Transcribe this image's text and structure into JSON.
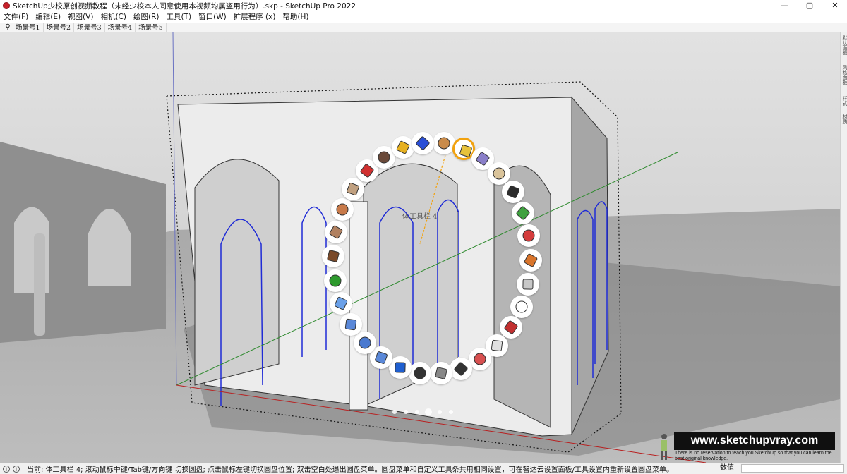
{
  "window": {
    "title": "SketchUp少校原创视频教程（未经少校本人同意使用本视频均属盗用行为）.skp - SketchUp Pro 2022",
    "minimize": "—",
    "maximize": "▢",
    "close": "✕"
  },
  "menu": [
    "文件(F)",
    "编辑(E)",
    "视图(V)",
    "相机(C)",
    "绘图(R)",
    "工具(T)",
    "窗口(W)",
    "扩展程序 (x)",
    "帮助(H)"
  ],
  "scenes": [
    "场景号1",
    "场景号2",
    "场景号3",
    "场景号4",
    "场景号5"
  ],
  "right_panel": [
    "默认面板",
    "风格面板",
    "样式",
    "材质"
  ],
  "pie_menu": {
    "caption": "体工具栏 4",
    "page_count": 6,
    "active_page": 3,
    "accent": "#f2a20e",
    "items": [
      {
        "name": "solid-tool-icon",
        "active": false
      },
      {
        "name": "outer-shell-icon",
        "active": true
      },
      {
        "name": "intersect-icon",
        "active": false
      },
      {
        "name": "subtract-icon",
        "active": false
      },
      {
        "name": "box-icon",
        "active": false
      },
      {
        "name": "add-solid-icon",
        "active": false
      },
      {
        "name": "trim-solid-icon",
        "active": false
      },
      {
        "name": "push-arrow-icon",
        "active": false
      },
      {
        "name": "pull-arrow-icon",
        "active": false
      },
      {
        "name": "rounded-box-icon",
        "active": false
      },
      {
        "name": "layers-icon",
        "active": false
      },
      {
        "name": "sphere-shade-icon",
        "active": false
      },
      {
        "name": "bend-icon",
        "active": false
      },
      {
        "name": "circle-icon",
        "active": false
      },
      {
        "name": "polyhedron-icon",
        "active": false
      },
      {
        "name": "sphere-line-icon",
        "active": false
      },
      {
        "name": "gizmo-icon",
        "active": false
      },
      {
        "name": "copy-box-icon",
        "active": false
      },
      {
        "name": "slice-box-icon",
        "active": false
      },
      {
        "name": "move-box-icon",
        "active": false
      },
      {
        "name": "wave-icon",
        "active": false
      },
      {
        "name": "axis-icon",
        "active": false
      },
      {
        "name": "stairs-icon",
        "active": false
      },
      {
        "name": "diagonal-icon",
        "active": false
      },
      {
        "name": "house-icon",
        "active": false
      },
      {
        "name": "mirror-icon",
        "active": false
      },
      {
        "name": "curve-dots-icon",
        "active": false
      },
      {
        "name": "shape-icon",
        "active": false
      },
      {
        "name": "warning-icon",
        "active": false
      },
      {
        "name": "bow-icon",
        "active": false
      }
    ]
  },
  "watermark": {
    "url": "www.sketchupvray.com",
    "tagline": "There is no reservation to teach you SketchUp so that you can learn the best original knowledge."
  },
  "status": {
    "text": "当前:  体工具栏 4;   滚动鼠标中键/Tab键/方向键 切换圆盘; 点击鼠标左键切换圆盘位置; 双击空白处退出圆盘菜单。圆盘菜单和自定义工具条共用相同设置，可在智达云设置面板/工具设置内重新设置圆盘菜单。",
    "vcb_label": "数值"
  }
}
